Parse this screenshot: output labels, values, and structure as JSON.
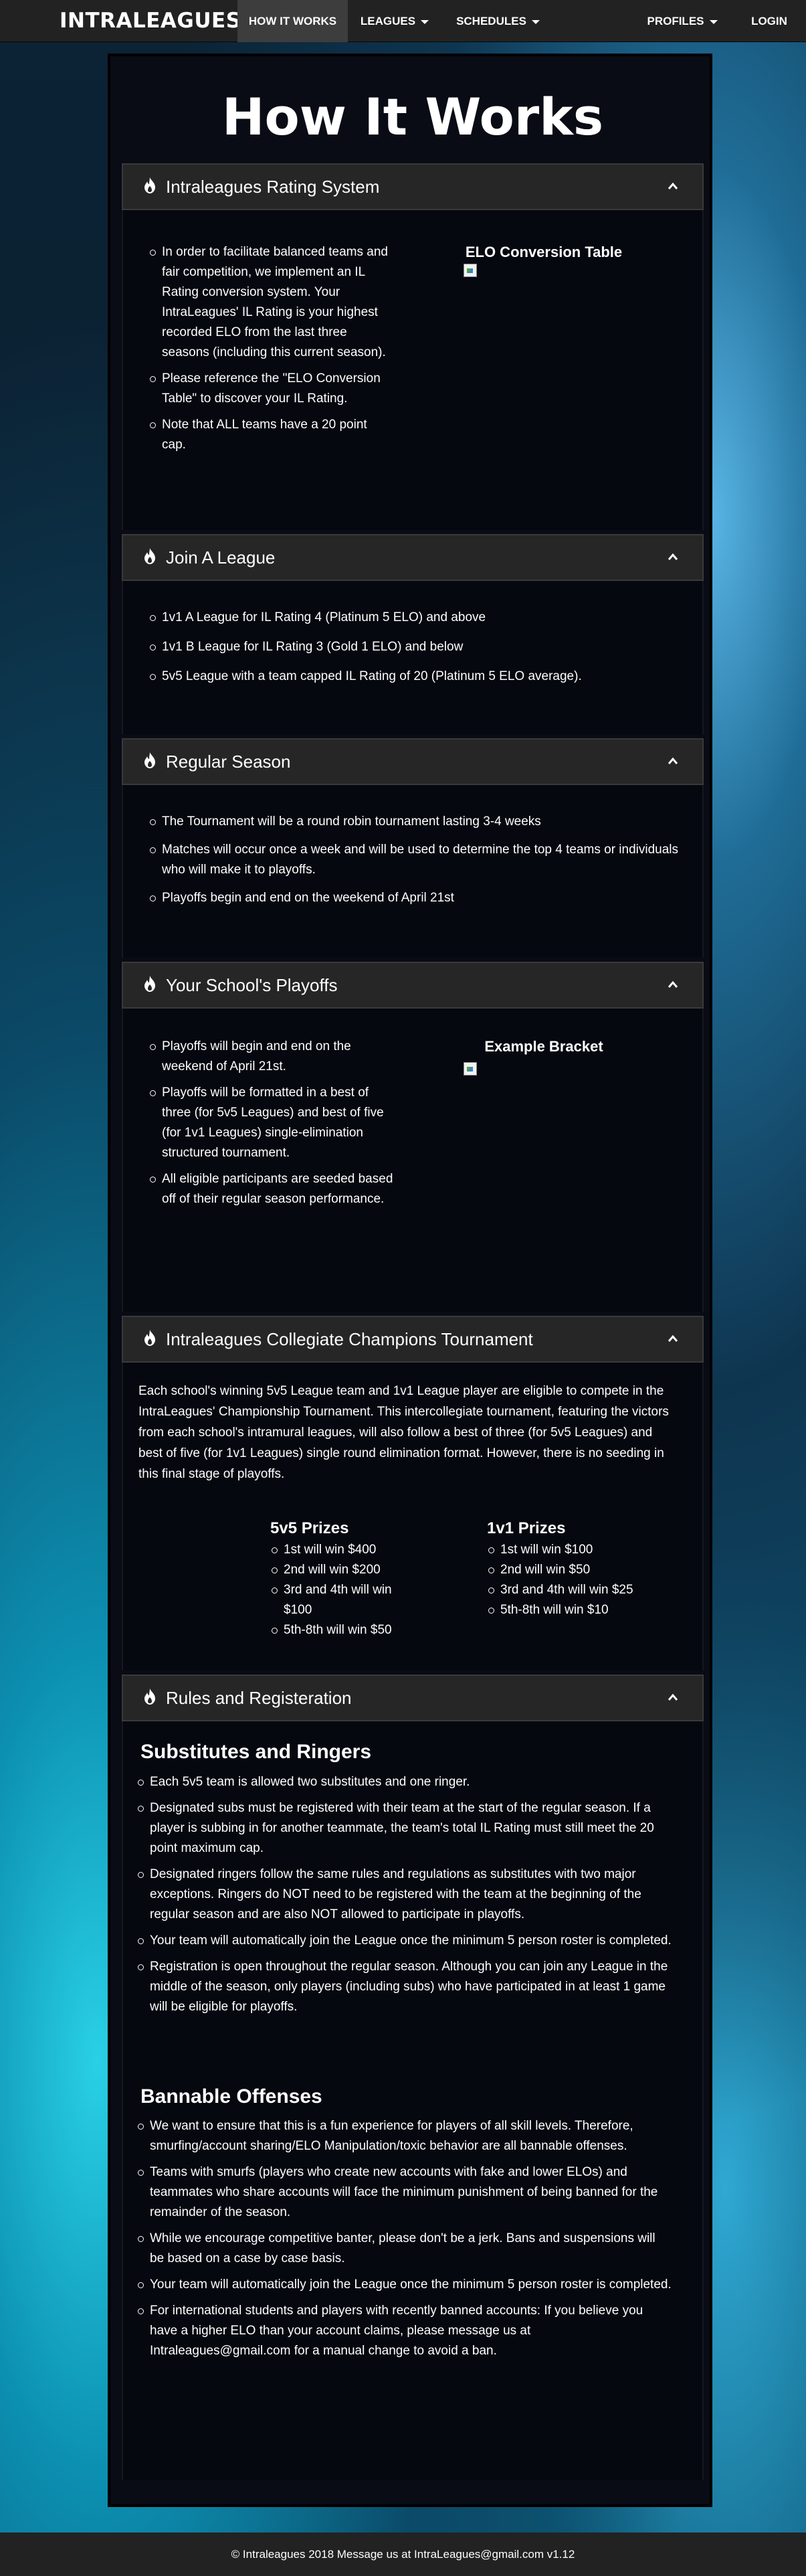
{
  "navbar": {
    "brand": "INTRALEAGUES",
    "items": [
      {
        "label": "HOW IT WORKS"
      },
      {
        "label": "LEAGUES"
      },
      {
        "label": "SCHEDULES"
      },
      {
        "label": "PROFILES"
      },
      {
        "label": "LOGIN"
      }
    ]
  },
  "page_title": "How It Works",
  "sections": [
    {
      "title": "Intraleagues Rating System",
      "bullets": [
        "In order to facilitate balanced teams and fair competition, we implement an IL Rating conversion system. Your IntraLeagues' IL Rating is your highest recorded ELO from the last three seasons (including this current season).",
        "Please reference the \"ELO Conversion Table\" to discover your IL Rating.",
        "Note that ALL teams have a 20 point cap."
      ],
      "side_title": "ELO Conversion Table"
    },
    {
      "title": "Join A League",
      "bullets": [
        "1v1 A League for IL Rating 4 (Platinum 5 ELO) and above",
        "1v1 B League for IL Rating 3 (Gold 1 ELO) and below",
        "5v5 League with a team capped IL Rating of 20 (Platinum 5 ELO average)."
      ]
    },
    {
      "title": "Regular Season",
      "bullets": [
        "The Tournament will be a round robin tournament lasting 3-4 weeks",
        "Matches will occur once a week and will be used to determine the top 4 teams or individuals who will make it to playoffs.",
        "Playoffs begin and end on the weekend of April 21st"
      ]
    },
    {
      "title": "Your School's Playoffs",
      "bullets": [
        "Playoffs will begin and end on the weekend of April 21st.",
        "Playoffs will be formatted in a best of three (for 5v5 Leagues) and best of five (for 1v1 Leagues) single-elimination structured tournament.",
        "All eligible participants are seeded based off of their regular season performance."
      ],
      "side_title": "Example Bracket"
    },
    {
      "title": "Intraleagues Collegiate Champions Tournament",
      "paragraph": "Each school's winning 5v5 League team and 1v1 League player are eligible to compete in the IntraLeagues' Championship Tournament. This intercollegiate tournament, featuring the victors from each school's intramural leagues, will also follow a best of three (for 5v5 Leagues) and best of five (for 1v1 Leagues) single round elimination format. However, there is no seeding in this final stage of playoffs.",
      "prizes_5v5": {
        "title": "5v5 Prizes",
        "items": [
          "1st will win $400",
          "2nd will win $200",
          "3rd and 4th will win $100",
          "5th-8th will win $50"
        ]
      },
      "prizes_1v1": {
        "title": "1v1 Prizes",
        "items": [
          "1st will win $100",
          "2nd will win $50",
          "3rd and 4th will win $25",
          "5th-8th will win $10"
        ]
      }
    },
    {
      "title": "Rules and Registeration",
      "subs_title": "Substitutes and Ringers",
      "subs_bullets": [
        "Each 5v5 team is allowed two substitutes and one ringer.",
        "Designated subs must be registered with their team at the start of the regular season. If a player is subbing in for another teammate, the team's total IL Rating must still meet the 20 point maximum cap.",
        "Designated ringers follow the same rules and regulations as substitutes with two major exceptions. Ringers do NOT need to be registered with the team at the beginning of the regular season and are also NOT allowed to participate in playoffs.",
        "Your team will automatically join the League once the minimum 5 person roster is completed.",
        "Registration is open throughout the regular season. Although you can join any League in the middle of the season, only players (including subs) who have participated in at least 1 game will be eligible for playoffs."
      ],
      "ban_title": "Bannable Offenses",
      "ban_bullets": [
        "We want to ensure that this is a fun experience for players of all skill levels. Therefore, smurfing/account sharing/ELO Manipulation/toxic behavior are all bannable offenses.",
        "Teams with smurfs (players who create new accounts with fake and lower ELOs) and teammates who share accounts will face the minimum punishment of being banned for the remainder of the season.",
        "While we encourage competitive banter, please don't be a jerk. Bans and suspensions will be based on a case by case basis.",
        "Your team will automatically join the League once the minimum 5 person roster is completed.",
        "For international students and players with recently banned accounts: If you believe you have a higher ELO than your account claims, please message us at Intraleagues@gmail.com for a manual change to avoid a ban."
      ]
    }
  ],
  "footer": "© Intraleagues 2018 Message us at IntraLeagues@gmail.com v1.12"
}
